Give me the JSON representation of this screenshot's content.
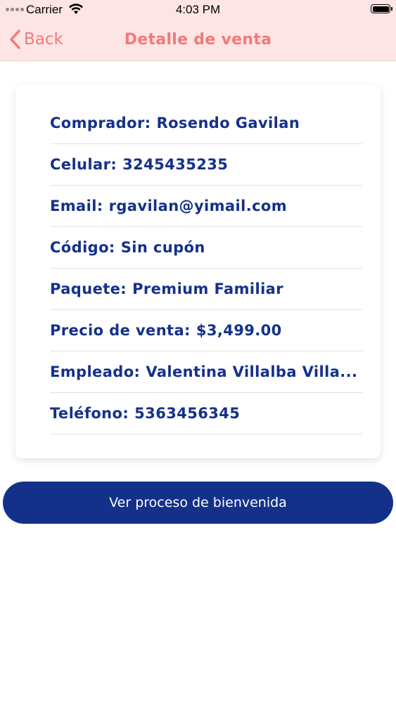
{
  "status_bar": {
    "carrier": "Carrier",
    "time": "4:03 PM"
  },
  "nav": {
    "back_label": "Back",
    "title": "Detalle de venta"
  },
  "details": [
    {
      "label": "Comprador:",
      "value": "Rosendo Gavilan"
    },
    {
      "label": "Celular:",
      "value": "3245435235"
    },
    {
      "label": "Email:",
      "value": "rgavilan@yimail.com"
    },
    {
      "label": "Código:",
      "value": "Sin cupón"
    },
    {
      "label": "Paquete:",
      "value": "Premium Familiar"
    },
    {
      "label": "Precio de venta:",
      "value": "$3,499.00"
    },
    {
      "label": "Empleado:",
      "value": "Valentina Villalba Villa..."
    },
    {
      "label": "Teléfono:",
      "value": "5363456345"
    }
  ],
  "actions": {
    "welcome_button_label": "Ver proceso de bienvenida"
  },
  "colors": {
    "header_bg": "#fde5e5",
    "accent": "#f17a7a",
    "primary": "#14318a"
  }
}
